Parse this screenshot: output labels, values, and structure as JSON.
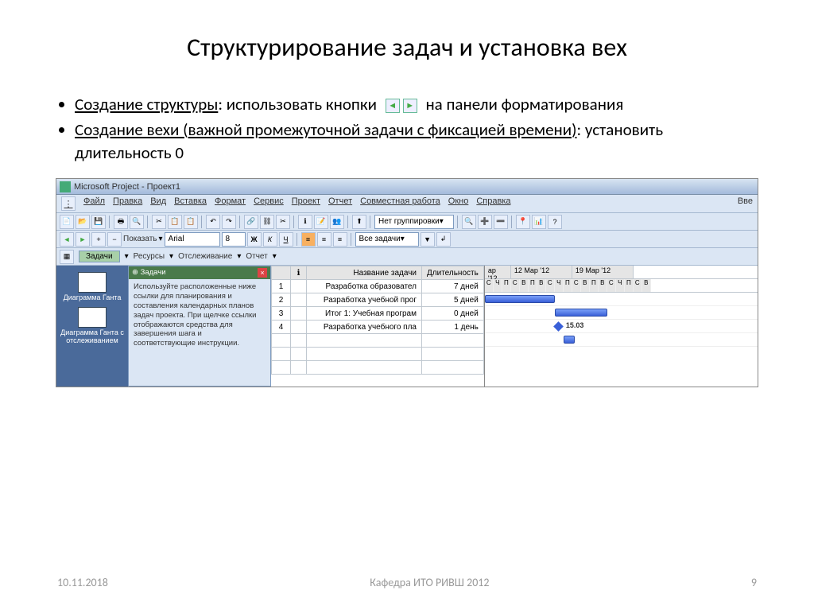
{
  "slide": {
    "title": "Структурирование задач и установка вех",
    "bullet1_underline": "Создание структуры",
    "bullet1_rest_a": ": использовать кнопки",
    "bullet1_rest_b": "на панели форматирования",
    "bullet2_underline": "Создание вехи (важной промежуточной задачи с фиксацией времени)",
    "bullet2_rest": ": установить длительность 0"
  },
  "msproject": {
    "titlebar": "Microsoft Project - Проект1",
    "menu": [
      "Файл",
      "Правка",
      "Вид",
      "Вставка",
      "Формат",
      "Сервис",
      "Проект",
      "Отчет",
      "Совместная работа",
      "Окно",
      "Справка"
    ],
    "field_label_right": "Вве",
    "group_dd": "Нет группировки",
    "format": {
      "show_label": "Показать",
      "font": "Arial",
      "size": "8",
      "bold": "Ж",
      "italic": "К",
      "und": "Ч",
      "filter_dd": "Все задачи"
    },
    "guide": {
      "tasks": "Задачи",
      "resources": "Ресурсы",
      "tracking": "Отслеживание",
      "report": "Отчет"
    },
    "view_bar": {
      "v1": "Диаграмма Ганта",
      "v2": "Диаграмма Ганта с отслеживанием"
    },
    "help": {
      "title": "Задачи",
      "body": "Используйте расположенные ниже ссылки для планирования и составления календарных планов задач проекта. При щелчке ссылки отображаются средства для завершения шага и соответствующие инструкции."
    },
    "grid": {
      "col_info": "",
      "col_name": "Название задачи",
      "col_dur": "Длительность",
      "rows": [
        {
          "n": "1",
          "name": "Разработка образовател",
          "dur": "7 дней"
        },
        {
          "n": "2",
          "name": "Разработка учебной прог",
          "dur": "5 дней"
        },
        {
          "n": "3",
          "name": "Итог 1: Учебная програм",
          "dur": "0 дней"
        },
        {
          "n": "4",
          "name": "Разработка учебного пла",
          "dur": "1 день"
        }
      ]
    },
    "gantt": {
      "hd1": "ар '12",
      "hd2": "12 Мар '12",
      "hd3": "19 Мар '12",
      "days": [
        "С",
        "Ч",
        "П",
        "С",
        "В",
        "П",
        "В",
        "С",
        "Ч",
        "П",
        "С",
        "В",
        "П",
        "В",
        "С",
        "Ч",
        "П",
        "С",
        "В"
      ],
      "ms_label": "15.03"
    }
  },
  "footer": {
    "date": "10.11.2018",
    "center": "Кафедра ИТО РИВШ 2012",
    "page": "9"
  }
}
